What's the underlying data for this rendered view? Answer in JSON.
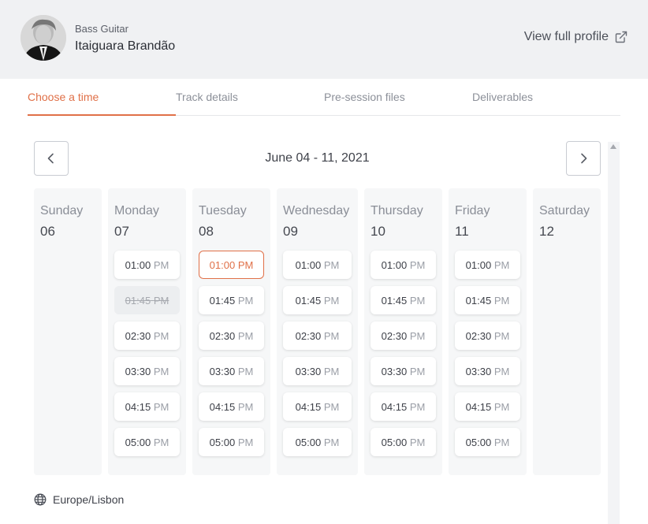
{
  "header": {
    "role": "Bass Guitar",
    "name": "Itaiguara Brandão",
    "profile_link": "View full profile"
  },
  "tabs": [
    {
      "label": "Choose a time",
      "active": true
    },
    {
      "label": "Track details",
      "active": false
    },
    {
      "label": "Pre-session files",
      "active": false
    },
    {
      "label": "Deliverables",
      "active": false
    }
  ],
  "calendar": {
    "week_title": "June 04 - 11, 2021",
    "days": [
      {
        "name": "Sunday",
        "date": "06",
        "slots": []
      },
      {
        "name": "Monday",
        "date": "07",
        "slots": [
          {
            "time": "01:00",
            "ampm": "PM",
            "state": "available"
          },
          {
            "time": "01:45",
            "ampm": "PM",
            "state": "disabled"
          },
          {
            "time": "02:30",
            "ampm": "PM",
            "state": "available"
          },
          {
            "time": "03:30",
            "ampm": "PM",
            "state": "available"
          },
          {
            "time": "04:15",
            "ampm": "PM",
            "state": "available"
          },
          {
            "time": "05:00",
            "ampm": "PM",
            "state": "available"
          }
        ]
      },
      {
        "name": "Tuesday",
        "date": "08",
        "slots": [
          {
            "time": "01:00",
            "ampm": "PM",
            "state": "selected"
          },
          {
            "time": "01:45",
            "ampm": "PM",
            "state": "available"
          },
          {
            "time": "02:30",
            "ampm": "PM",
            "state": "available"
          },
          {
            "time": "03:30",
            "ampm": "PM",
            "state": "available"
          },
          {
            "time": "04:15",
            "ampm": "PM",
            "state": "available"
          },
          {
            "time": "05:00",
            "ampm": "PM",
            "state": "available"
          }
        ]
      },
      {
        "name": "Wednesday",
        "date": "09",
        "slots": [
          {
            "time": "01:00",
            "ampm": "PM",
            "state": "available"
          },
          {
            "time": "01:45",
            "ampm": "PM",
            "state": "available"
          },
          {
            "time": "02:30",
            "ampm": "PM",
            "state": "available"
          },
          {
            "time": "03:30",
            "ampm": "PM",
            "state": "available"
          },
          {
            "time": "04:15",
            "ampm": "PM",
            "state": "available"
          },
          {
            "time": "05:00",
            "ampm": "PM",
            "state": "available"
          }
        ]
      },
      {
        "name": "Thursday",
        "date": "10",
        "slots": [
          {
            "time": "01:00",
            "ampm": "PM",
            "state": "available"
          },
          {
            "time": "01:45",
            "ampm": "PM",
            "state": "available"
          },
          {
            "time": "02:30",
            "ampm": "PM",
            "state": "available"
          },
          {
            "time": "03:30",
            "ampm": "PM",
            "state": "available"
          },
          {
            "time": "04:15",
            "ampm": "PM",
            "state": "available"
          },
          {
            "time": "05:00",
            "ampm": "PM",
            "state": "available"
          }
        ]
      },
      {
        "name": "Friday",
        "date": "11",
        "slots": [
          {
            "time": "01:00",
            "ampm": "PM",
            "state": "available"
          },
          {
            "time": "01:45",
            "ampm": "PM",
            "state": "available"
          },
          {
            "time": "02:30",
            "ampm": "PM",
            "state": "available"
          },
          {
            "time": "03:30",
            "ampm": "PM",
            "state": "available"
          },
          {
            "time": "04:15",
            "ampm": "PM",
            "state": "available"
          },
          {
            "time": "05:00",
            "ampm": "PM",
            "state": "available"
          }
        ]
      },
      {
        "name": "Saturday",
        "date": "12",
        "slots": []
      }
    ]
  },
  "timezone": "Europe/Lisbon",
  "colors": {
    "accent": "#e07048",
    "header_bg": "#f0f1f3",
    "column_bg": "#f6f7f8"
  },
  "icons": {
    "profile_link": "external-link-icon",
    "prev": "chevron-left-icon",
    "next": "chevron-right-icon",
    "timezone": "globe-icon"
  }
}
